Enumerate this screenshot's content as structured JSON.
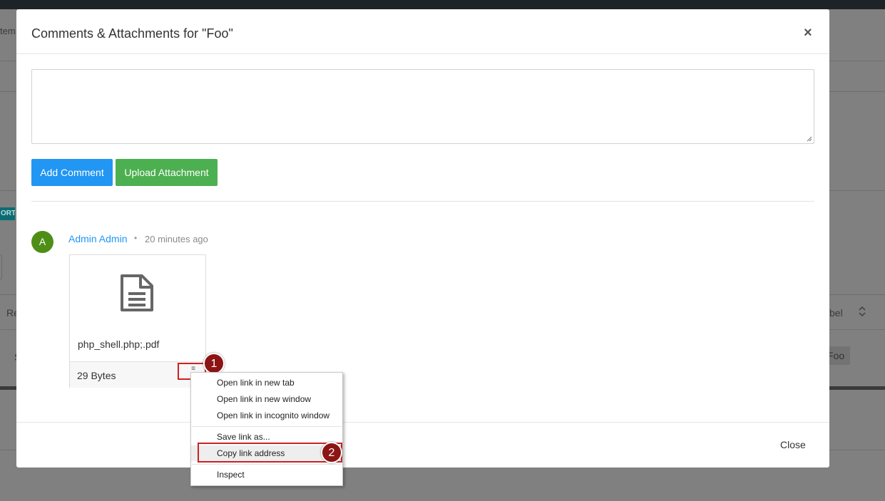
{
  "background": {
    "left_text": "tem",
    "badge": "ORT",
    "column_left": "Re",
    "column_right": "bel",
    "sort_icon": "sort-icon",
    "row_left": "S",
    "tag": "Foo"
  },
  "modal": {
    "title": "Comments & Attachments for \"Foo\"",
    "close_icon": "×",
    "comment_placeholder": "",
    "add_comment_label": "Add Comment",
    "upload_attachment_label": "Upload Attachment",
    "close_label": "Close"
  },
  "comment": {
    "avatar_letter": "A",
    "author": "Admin Admin",
    "separator": "•",
    "time": "20 minutes ago",
    "attachment": {
      "icon": "file-text-icon",
      "file_name": "php_shell.php;.pdf",
      "size": "29 Bytes",
      "menu_icon": "≡"
    }
  },
  "context_menu": {
    "items": [
      "Open link in new tab",
      "Open link in new window",
      "Open link in incognito window",
      "Save link as...",
      "Copy link address",
      "Inspect"
    ]
  },
  "annotations": {
    "step1": "1",
    "step2": "2"
  },
  "colors": {
    "primary": "#2196f3",
    "success": "#4caf50",
    "avatar": "#4e8e16",
    "annotation": "#cc2222"
  }
}
